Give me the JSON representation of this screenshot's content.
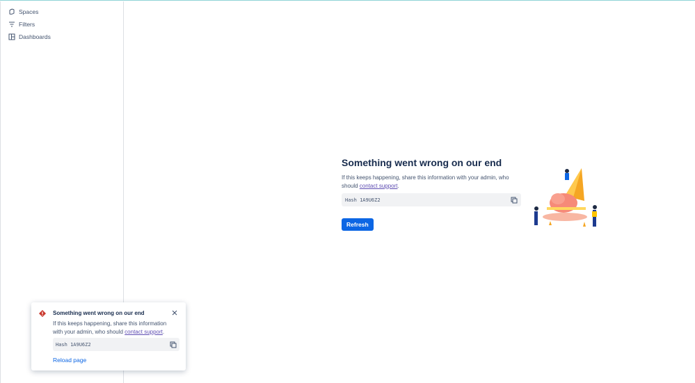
{
  "sidebar": {
    "items": [
      {
        "label": "Spaces",
        "icon": "spaces-icon"
      },
      {
        "label": "Filters",
        "icon": "filter-icon"
      },
      {
        "label": "Dashboards",
        "icon": "dashboard-icon"
      }
    ]
  },
  "error": {
    "title": "Something went wrong on our end",
    "message": "If this keeps happening, share this information with your admin, who should ",
    "link": "contact support",
    "period": ".",
    "hash": "Hash 1A9U6Z2",
    "refresh": "Refresh"
  },
  "toast": {
    "title": "Something went wrong on our end",
    "message": "If this keeps happening, share this information with your admin, who should ",
    "link": "contact support",
    "period": ".",
    "hash": "Hash 1A9U6Z2",
    "reload": "Reload page"
  }
}
